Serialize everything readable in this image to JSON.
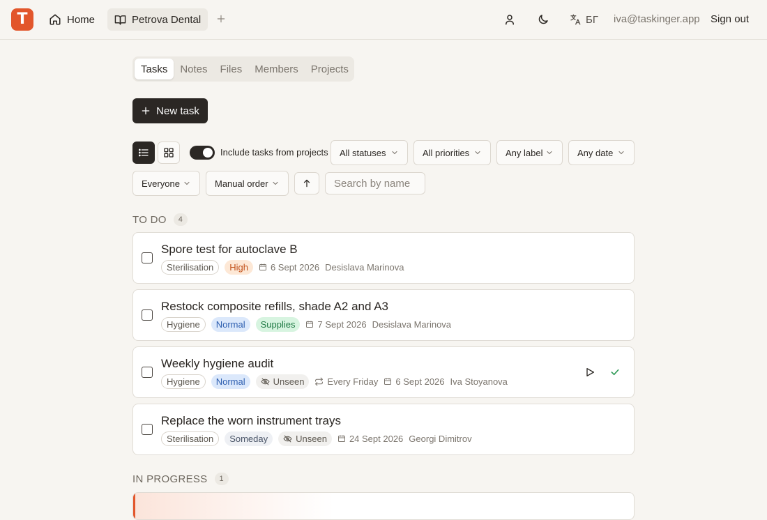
{
  "header": {
    "logo_letter": "T",
    "home_label": "Home",
    "workspace_label": "Petrova Dental",
    "language_label": "БГ",
    "user_email": "iva@taskinger.app",
    "sign_out_label": "Sign out",
    "brand_color": "#e2562b"
  },
  "section_tabs": [
    "Tasks",
    "Notes",
    "Files",
    "Members",
    "Projects"
  ],
  "active_section": "Tasks",
  "new_task_label": "New task",
  "toolbar": {
    "include_projects_label": "Include tasks from projects",
    "include_projects_on": true,
    "status_filter": "All statuses",
    "priority_filter": "All priorities",
    "label_filter": "Any label",
    "date_filter": "Any date",
    "assignee_filter": "Everyone",
    "sort_order": "Manual order",
    "search_placeholder": "Search by name"
  },
  "groups": [
    {
      "title": "TO DO",
      "count": "4",
      "tasks": [
        {
          "title": "Spore test for autoclave B",
          "label": "Sterilisation",
          "priority": "High",
          "due": "6 Sept 2026",
          "assignee": "Desislava Marinova"
        },
        {
          "title": "Restock composite refills, shade A2 and A3",
          "label": "Hygiene",
          "priority": "Normal",
          "tag": "Supplies",
          "due": "7 Sept 2026",
          "assignee": "Desislava Marinova"
        },
        {
          "title": "Weekly hygiene audit",
          "label": "Hygiene",
          "priority": "Normal",
          "visibility": "Unseen",
          "recurrence": "Every Friday",
          "due": "6 Sept 2026",
          "assignee": "Iva Stoyanova"
        },
        {
          "title": "Replace the worn instrument trays",
          "label": "Sterilisation",
          "priority": "Someday",
          "visibility": "Unseen",
          "due": "24 Sept 2026",
          "assignee": "Georgi Dimitrov"
        }
      ]
    },
    {
      "title": "IN PROGRESS",
      "count": "1"
    }
  ]
}
